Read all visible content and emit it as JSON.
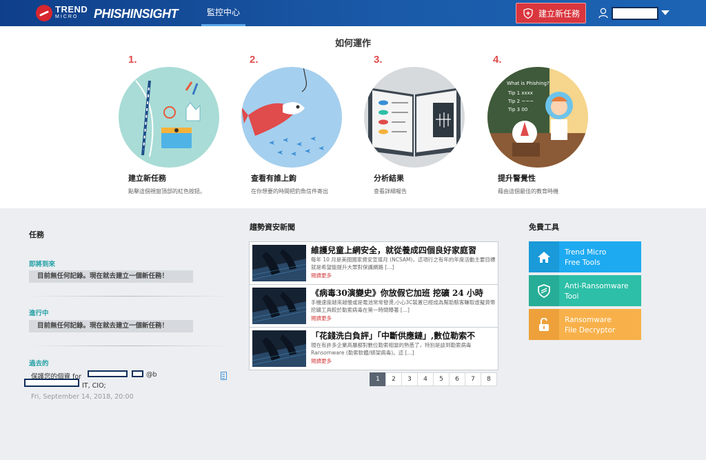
{
  "header": {
    "brand_trend": "TREND",
    "brand_micro": "MICRO",
    "product": "PHISHINSIGHT",
    "nav_tab": "監控中心",
    "create_button": "建立新任務",
    "accent_color": "#d9363e"
  },
  "how_it_works": {
    "title": "如何運作",
    "steps": [
      {
        "number": "1.",
        "title": "建立新任務",
        "desc": "點擊這個視窗頂部的紅色按鈕。"
      },
      {
        "number": "2.",
        "title": "查看有誰上鉤",
        "desc": "在你想要的時間把釣魚信件寄出"
      },
      {
        "number": "3.",
        "title": "分析結果",
        "desc": "查看詳細報告"
      },
      {
        "number": "4.",
        "title": "提升警覺性",
        "desc": "藉由這個最佳的教育時機"
      }
    ],
    "step4_board_text": [
      "What is Phishing?",
      "Tip 1 xxxx",
      "Tip 2 ~~~",
      "Tip 3 00"
    ]
  },
  "tasks": {
    "title": "任務",
    "upcoming_label": "即將到來",
    "upcoming_empty": "目前無任何記錄。現在就去建立一個新任務！",
    "in_progress_label": "進行中",
    "in_progress_empty": "目前無任何記錄。現在就去建立一個新任務！",
    "past_label": "過去的",
    "past_item": {
      "title_prefix": "保護您的個資 for",
      "title_suffix": "@b",
      "line2": "IT, CIO;",
      "date": "Fri, September 14, 2018, 20:00"
    }
  },
  "news": {
    "title": "趨勢資安新聞",
    "more_label": "閱讀更多",
    "items": [
      {
        "title": "維護兒童上網安全，就從養成四個良好家庭習",
        "body": "每年 10 月是美國國家資安宣導月 (NCSAM)，這項行之有年的年度活動主要目標就是希望能提升大眾對保護網路 [...]"
      },
      {
        "title": "《病毒30演變史》你放假它加班 挖礦 24 小時",
        "body": "手機速度越來越慢或是電池常常發燙,小心3C裝置已經成為幫助駭客賺取虛擬貨幣挖礦工具較於勒索病毒在第一時間曝著 [...]"
      },
      {
        "title": "「花錢洗白負評」「中斷供應鏈」,數位勒索不",
        "body": "現在有許多企業高層都對數位勒索相當的熟悉了，特別是談到勒索病毒Ransomware (勒索軟體/綁架病毒)。這 [...]"
      }
    ],
    "pages": [
      "1",
      "2",
      "3",
      "4",
      "5",
      "6",
      "7",
      "8"
    ],
    "active_page": "1"
  },
  "tools": {
    "title": "免費工具",
    "items": [
      {
        "line1": "Trend Micro",
        "line2": "Free Tools",
        "color": "#1eaaf1",
        "icon": "home-icon"
      },
      {
        "line1": "Anti-Ransomware",
        "line2": "Tool",
        "color": "#2dbfa7",
        "icon": "shield-icon"
      },
      {
        "line1": "Ransomware",
        "line2": "File Decryptor",
        "color": "#f8b14a",
        "icon": "unlock-icon"
      }
    ]
  }
}
